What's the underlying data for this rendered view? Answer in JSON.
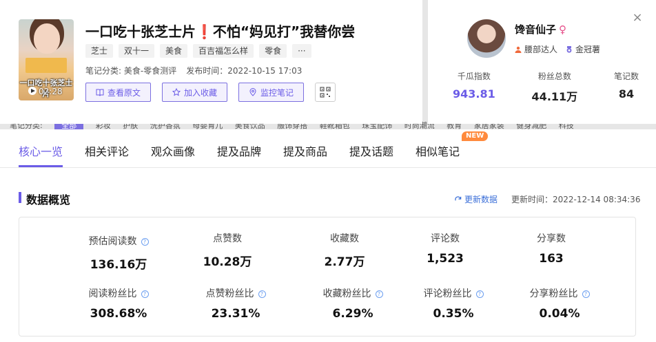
{
  "note": {
    "cover_text": "一口吃十张芝士片",
    "duration": "02:28",
    "title_part1": "一口吃十张芝士片",
    "title_excl": "❗",
    "title_part2": "不怕“妈见打”我替你尝",
    "tags": [
      "芝士",
      "双十一",
      "美食",
      "百吉福怎么样",
      "零食",
      "···"
    ],
    "category_label": "笔记分类: 美食-零食测评",
    "publish_label": "发布时间：2022-10-15 17:03",
    "actions": {
      "view_original": "查看原文",
      "add_favorite": "加入收藏",
      "monitor_note": "监控笔记"
    }
  },
  "category_strip": [
    "笔记分类:",
    "全部",
    "彩妆",
    "护肤",
    "洗护香氛",
    "母婴育儿",
    "美食饮品",
    "服饰穿搭",
    "鞋靴箱包",
    "珠宝配饰",
    "时尚潮流",
    "教育",
    "家居家装",
    "健身减肥",
    "科技"
  ],
  "author": {
    "name": "馋音仙子",
    "gender_symbol": "♀",
    "badge_talent": "腰部达人",
    "badge_level": "金冠薯",
    "stats": [
      {
        "label": "千瓜指数",
        "value": "943.81"
      },
      {
        "label": "粉丝总数",
        "value": "44.11万"
      },
      {
        "label": "笔记数",
        "value": "84"
      }
    ]
  },
  "tabs": [
    {
      "label": "核心一览",
      "active": true
    },
    {
      "label": "相关评论"
    },
    {
      "label": "观众画像"
    },
    {
      "label": "提及品牌"
    },
    {
      "label": "提及商品"
    },
    {
      "label": "提及话题"
    },
    {
      "label": "相似笔记",
      "badge": "NEW"
    }
  ],
  "overview": {
    "title": "数据概览",
    "refresh_label": "更新数据",
    "update_time": "更新时间：2022-12-14 08:34:36",
    "metrics_row1": [
      {
        "label": "预估阅读数",
        "value": "136.16万",
        "help": true
      },
      {
        "label": "点赞数",
        "value": "10.28万"
      },
      {
        "label": "收藏数",
        "value": "2.77万"
      },
      {
        "label": "评论数",
        "value": "1,523"
      },
      {
        "label": "分享数",
        "value": "163"
      }
    ],
    "metrics_row2": [
      {
        "label": "阅读粉丝比",
        "value": "308.68%",
        "help": true
      },
      {
        "label": "点赞粉丝比",
        "value": "23.31%",
        "help": true
      },
      {
        "label": "收藏粉丝比",
        "value": "6.29%",
        "help": true
      },
      {
        "label": "评论粉丝比",
        "value": "0.35%",
        "help": true
      },
      {
        "label": "分享粉丝比",
        "value": "0.04%",
        "help": true
      }
    ]
  },
  "colors": {
    "accent": "#6b5ce7",
    "link": "#3b6fd8",
    "badge_new": "#ff8a3d",
    "title_excl": "#e1251b"
  }
}
